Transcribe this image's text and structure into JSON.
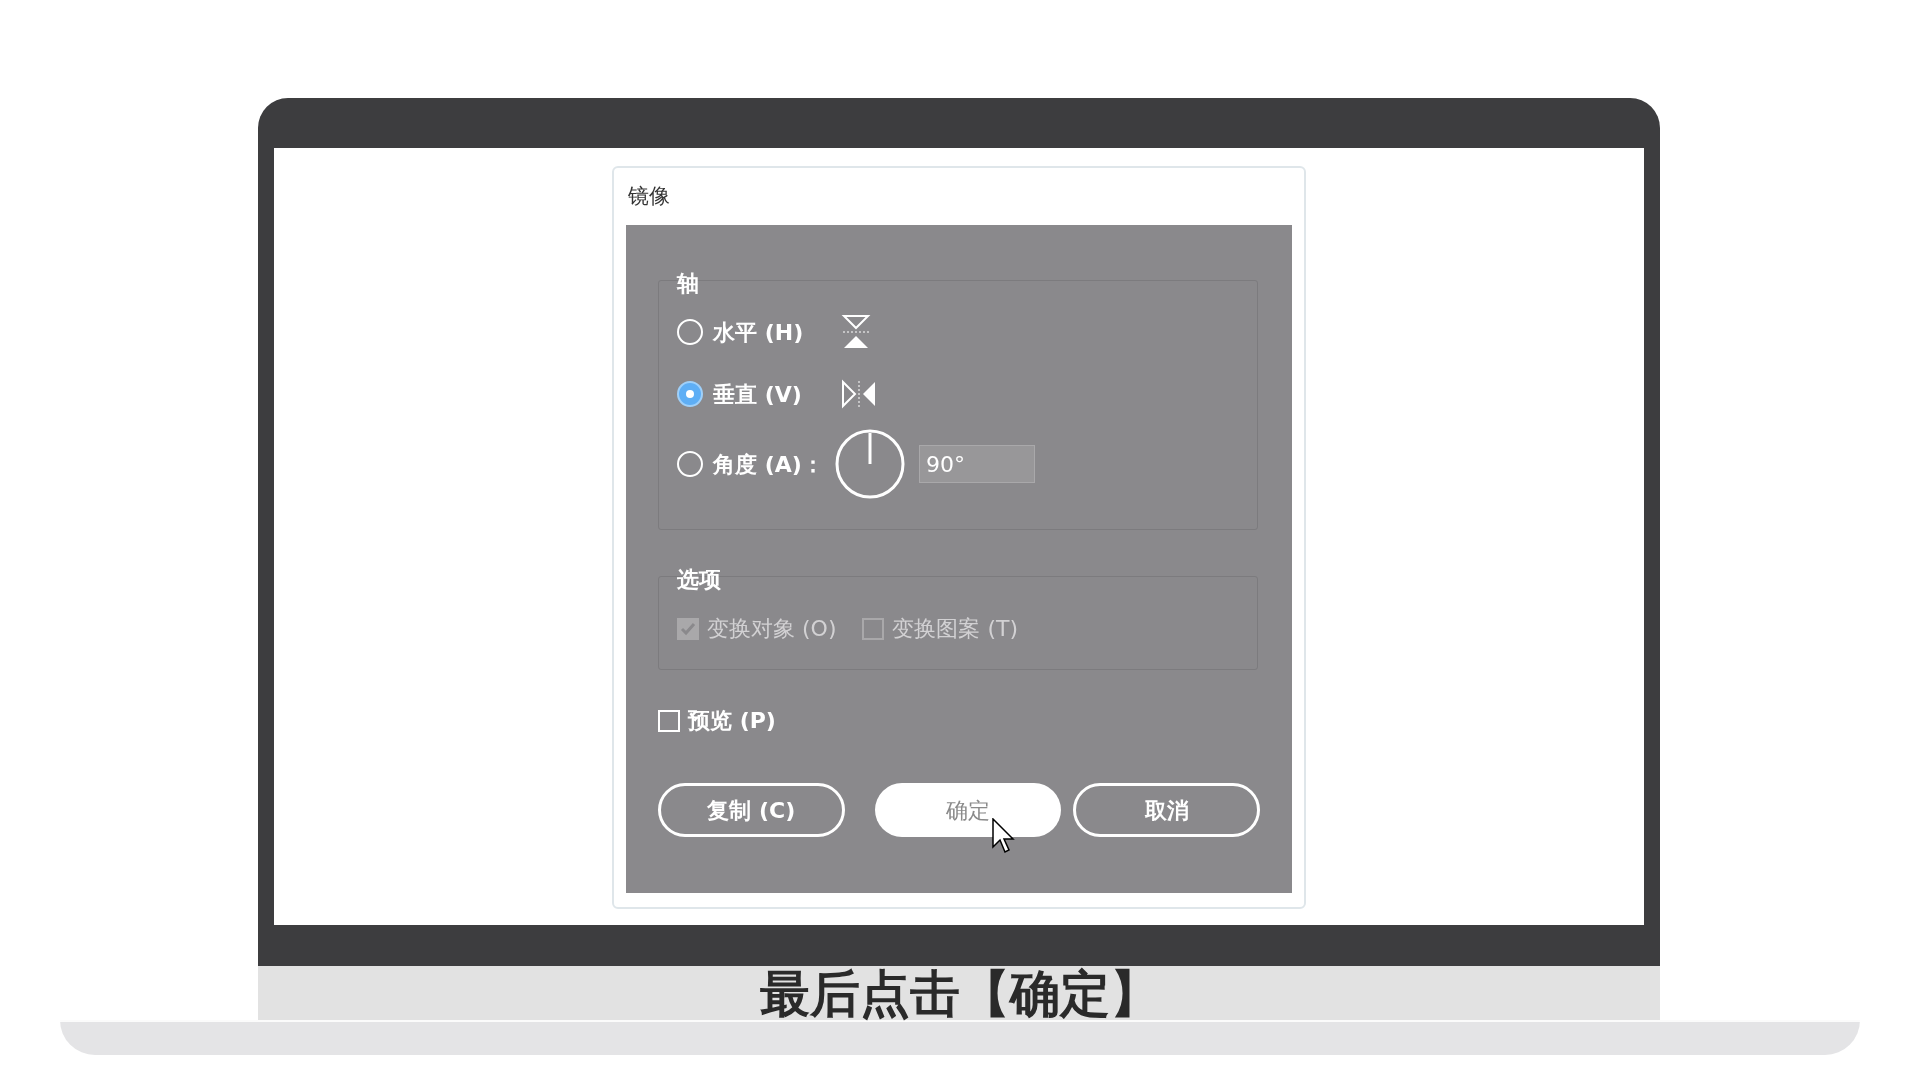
{
  "dialog": {
    "title": "镜像",
    "axis_group": {
      "label": "轴",
      "options": [
        {
          "kind": "horizontal",
          "label": "水平 (H)",
          "selected": false
        },
        {
          "kind": "vertical",
          "label": "垂直 (V)",
          "selected": true
        },
        {
          "kind": "angle",
          "label": "角度 (A)：",
          "selected": false
        }
      ],
      "angle_value": "90°"
    },
    "options_group": {
      "label": "选项",
      "checkboxes": [
        {
          "label": "变换对象 (O)",
          "checked": true,
          "disabled": true
        },
        {
          "label": "变换图案 (T)",
          "checked": false,
          "disabled": true
        }
      ]
    },
    "preview": {
      "label": "预览 (P)",
      "checked": false
    },
    "buttons": [
      {
        "label": "复制 (C)",
        "kind": "normal"
      },
      {
        "label": "确定",
        "kind": "default"
      },
      {
        "label": "取消",
        "kind": "normal"
      }
    ]
  },
  "subtitle": "最后点击【确定】"
}
